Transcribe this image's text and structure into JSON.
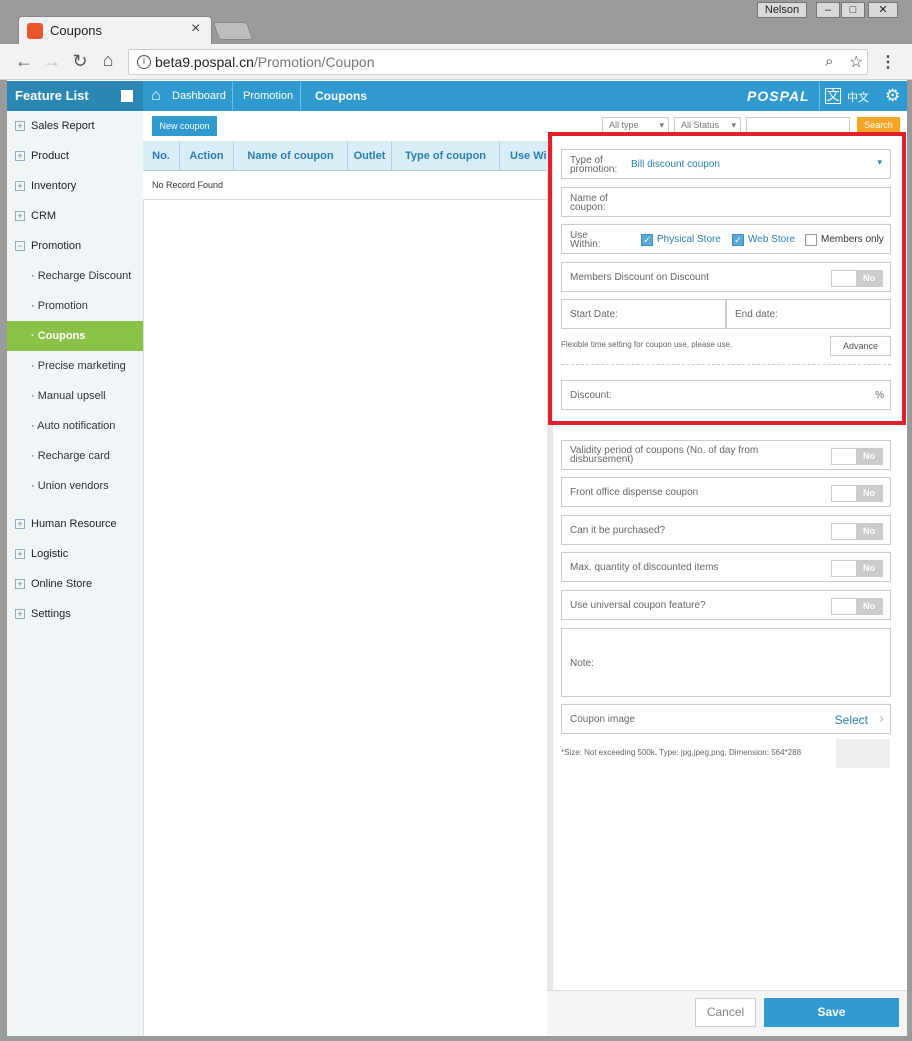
{
  "browser": {
    "tab_title": "Coupons",
    "user_badge": "Nelson",
    "url_host": "beta9.pospal.cn",
    "url_path": "/Promotion/Coupon"
  },
  "app": {
    "feature_list": "Feature List",
    "logo": "POSPAL",
    "language": "中文",
    "breadcrumb": [
      "Dashboard",
      "Promotion",
      "Coupons"
    ]
  },
  "sidebar": {
    "items_top": [
      "Sales Report",
      "Product",
      "Inventory",
      "CRM",
      "Promotion"
    ],
    "sub_items": [
      "Recharge Discount",
      "Promotion",
      "Coupons",
      "Precise marketing",
      "Manual upsell",
      "Auto notification",
      "Recharge card",
      "Union vendors"
    ],
    "items_bottom": [
      "Human Resource",
      "Logistic",
      "Online Store",
      "Settings"
    ],
    "active": "Coupons"
  },
  "list": {
    "new_coupon": "New coupon",
    "filter_type": "All type",
    "filter_status": "All Status",
    "search": "Search",
    "columns": [
      "No.",
      "Action",
      "Name of coupon",
      "Outlet",
      "Type of coupon",
      "Use Wi"
    ],
    "empty": "No Record Found"
  },
  "form": {
    "type_label": "Type of promotion:",
    "type_value": "Bill discount coupon",
    "name_label": "Name of coupon:",
    "use_within_label": "Use Within:",
    "physical_store": "Physical Store",
    "web_store": "Web Store",
    "members_only": "Members only",
    "members_discount": "Members Discount on Discount",
    "start_date": "Start Date:",
    "end_date": "End date:",
    "flexible_hint": "Flexible time setting for coupon use, please use.",
    "advance": "Advance",
    "discount": "Discount:",
    "percent": "%",
    "validity": "Validity period of coupons (No. of day from disbursement)",
    "front_office": "Front office dispense coupon",
    "purchasable": "Can it be purchased?",
    "max_quantity": "Max. quantity of discounted items",
    "universal": "Use universal coupon feature?",
    "note": "Note:",
    "coupon_image": "Coupon image",
    "select": "Select",
    "size_hint": "*Size: Not exceeding 500k, Type: jpg,jpeg,png, Dimension: 564*288",
    "toggle_no": "No",
    "cancel": "Cancel",
    "save": "Save"
  }
}
